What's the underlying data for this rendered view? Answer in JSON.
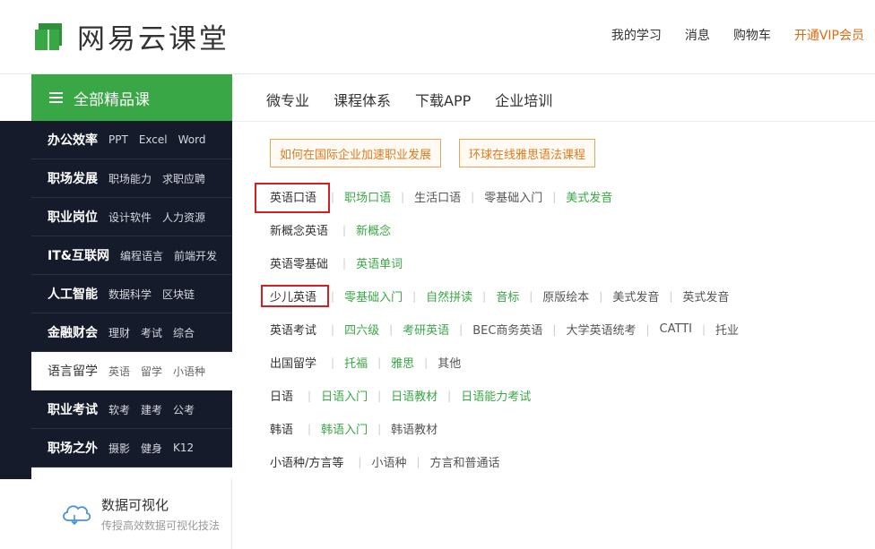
{
  "header": {
    "logo_text": "网易云课堂",
    "links": [
      "我的学习",
      "消息",
      "购物车"
    ],
    "vip_link": "开通VIP会员",
    "colors": {
      "brand_green": "#39a745",
      "vip_orange": "#e06a12"
    }
  },
  "all_courses": {
    "label": "全部精品课",
    "icon": "hamburger-icon"
  },
  "topnav": [
    "微专业",
    "课程体系",
    "下载APP",
    "企业培训"
  ],
  "sidebar": [
    {
      "cat": "办公效率",
      "subs": [
        "PPT",
        "Excel",
        "Word"
      ]
    },
    {
      "cat": "职场发展",
      "subs": [
        "职场能力",
        "求职应聘"
      ]
    },
    {
      "cat": "职业岗位",
      "subs": [
        "设计软件",
        "人力资源"
      ]
    },
    {
      "cat": "IT&互联网",
      "subs": [
        "编程语言",
        "前端开发"
      ]
    },
    {
      "cat": "人工智能",
      "subs": [
        "数据科学",
        "区块链"
      ]
    },
    {
      "cat": "金融财会",
      "subs": [
        "理财",
        "考试",
        "综合"
      ]
    },
    {
      "cat": "语言留学",
      "subs": [
        "英语",
        "留学",
        "小语种"
      ],
      "active": true
    },
    {
      "cat": "职业考试",
      "subs": [
        "软考",
        "建考",
        "公考"
      ]
    },
    {
      "cat": "职场之外",
      "subs": [
        "摄影",
        "健身",
        "K12"
      ]
    }
  ],
  "promo": {
    "title": "数据可视化",
    "subtitle": "传授高效数据可视化技法",
    "icon": "cloud-chart-icon"
  },
  "banners": [
    "如何在国际企业加速职业发展",
    "环球在线雅思语法课程"
  ],
  "content_rows": [
    {
      "head": "英语口语",
      "items": [
        {
          "t": "职场口语",
          "c": "green"
        },
        {
          "t": "生活口语",
          "c": "gray"
        },
        {
          "t": "零基础入门",
          "c": "gray"
        },
        {
          "t": "美式发音",
          "c": "green"
        }
      ]
    },
    {
      "head": "新概念英语",
      "items": [
        {
          "t": "新概念",
          "c": "green"
        }
      ]
    },
    {
      "head": "英语零基础",
      "items": [
        {
          "t": "英语单词",
          "c": "green"
        }
      ]
    },
    {
      "head": "少儿英语",
      "items": [
        {
          "t": "零基础入门",
          "c": "green"
        },
        {
          "t": "自然拼读",
          "c": "green"
        },
        {
          "t": "音标",
          "c": "green"
        },
        {
          "t": "原版绘本",
          "c": "gray"
        },
        {
          "t": "美式发音",
          "c": "gray"
        },
        {
          "t": "英式发音",
          "c": "gray"
        }
      ]
    },
    {
      "head": "英语考试",
      "items": [
        {
          "t": "四六级",
          "c": "green"
        },
        {
          "t": "考研英语",
          "c": "green"
        },
        {
          "t": "BEC商务英语",
          "c": "gray"
        },
        {
          "t": "大学英语统考",
          "c": "gray"
        },
        {
          "t": "CATTI",
          "c": "gray"
        },
        {
          "t": "托业",
          "c": "gray"
        }
      ]
    },
    {
      "head": "出国留学",
      "items": [
        {
          "t": "托福",
          "c": "green"
        },
        {
          "t": "雅思",
          "c": "green"
        },
        {
          "t": "其他",
          "c": "gray"
        }
      ]
    },
    {
      "head": "日语",
      "items": [
        {
          "t": "日语入门",
          "c": "green"
        },
        {
          "t": "日语教材",
          "c": "green"
        },
        {
          "t": "日语能力考试",
          "c": "green"
        }
      ]
    },
    {
      "head": "韩语",
      "items": [
        {
          "t": "韩语入门",
          "c": "green"
        },
        {
          "t": "韩语教材",
          "c": "gray"
        }
      ]
    },
    {
      "head": "小语种/方言等",
      "items": [
        {
          "t": "小语种",
          "c": "gray"
        },
        {
          "t": "方言和普通话",
          "c": "gray"
        }
      ]
    }
  ],
  "highlighted_heads": [
    "英语口语",
    "少儿英语"
  ],
  "highlight_color": "#d21f24"
}
